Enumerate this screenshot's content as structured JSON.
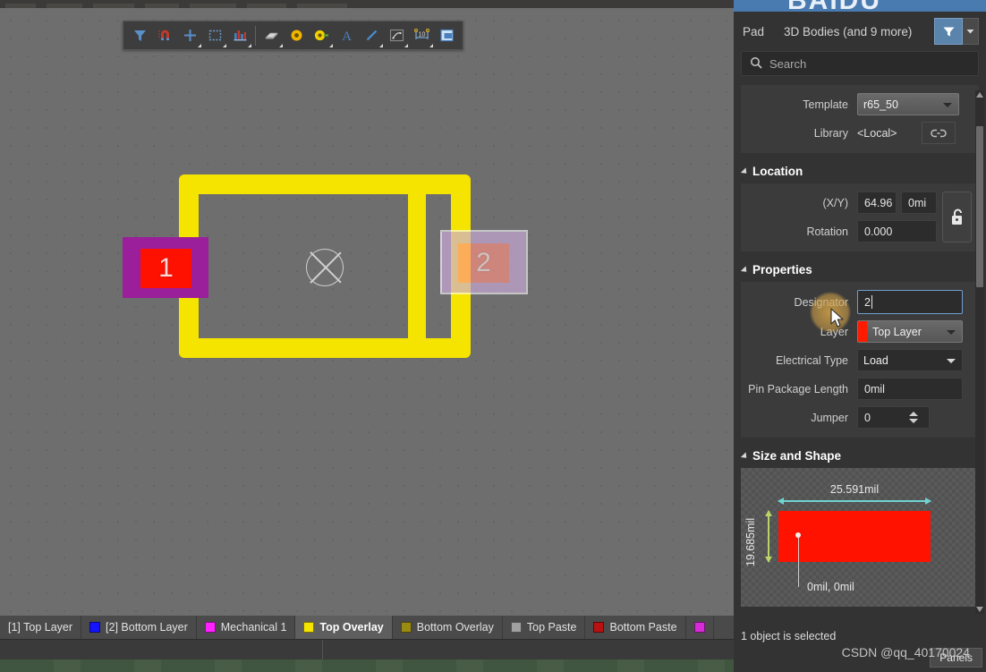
{
  "banner": {
    "text": "BAIDU"
  },
  "toolbar": {
    "items": [
      {
        "name": "filter-tool-icon",
        "label": "Filter"
      },
      {
        "name": "magnet-snap-icon",
        "label": "Snap"
      },
      {
        "name": "crosshair-place-icon",
        "label": "Place"
      },
      {
        "name": "selection-rectangle-icon",
        "label": "Select Area"
      },
      {
        "name": "component-place-icon",
        "label": "Place Component"
      },
      {
        "name": "three-d-body-icon",
        "label": "Place 3D Body"
      },
      {
        "name": "via-icon",
        "label": "Place Via"
      },
      {
        "name": "pad-icon",
        "label": "Place Pad"
      },
      {
        "name": "text-string-icon",
        "label": "Place String"
      },
      {
        "name": "line-icon",
        "label": "Place Line"
      },
      {
        "name": "arc-icon",
        "label": "Place Arc"
      },
      {
        "name": "dimension-icon",
        "label": "Place Dimension"
      },
      {
        "name": "polygon-pour-icon",
        "label": "Place Polygon Pour"
      }
    ]
  },
  "canvas": {
    "pads": [
      {
        "designator": "1",
        "selected": false
      },
      {
        "designator": "2",
        "selected": true
      }
    ]
  },
  "layer_tabs": [
    {
      "label": "[1] Top Layer",
      "color": "",
      "active": false,
      "swatch": false
    },
    {
      "label": "[2] Bottom Layer",
      "color": "#1414ff",
      "active": false,
      "swatch": true
    },
    {
      "label": "Mechanical 1",
      "color": "#ff21ff",
      "active": false,
      "swatch": true
    },
    {
      "label": "Top Overlay",
      "color": "#f5e400",
      "active": true,
      "swatch": true
    },
    {
      "label": "Bottom Overlay",
      "color": "#9c8b12",
      "active": false,
      "swatch": true
    },
    {
      "label": "Top Paste",
      "color": "#a0a0a0",
      "active": false,
      "swatch": true
    },
    {
      "label": "Bottom Paste",
      "color": "#b81111",
      "active": false,
      "swatch": true
    },
    {
      "label": "",
      "color": "#d62bd6",
      "active": false,
      "swatch": true
    }
  ],
  "panel": {
    "object_kind": "Pad",
    "scope": "3D Bodies (and 9 more)",
    "search": {
      "placeholder": "Search",
      "value": ""
    },
    "general": {
      "template_label": "Template",
      "template_value": "r65_50",
      "library_label": "Library",
      "library_value": "<Local>"
    },
    "location": {
      "title": "Location",
      "xy_label": "(X/Y)",
      "x_value": "64.96",
      "y_value": "0mi",
      "rotation_label": "Rotation",
      "rotation_value": "0.000"
    },
    "properties": {
      "title": "Properties",
      "designator_label": "Designator",
      "designator_value": "2",
      "layer_label": "Layer",
      "layer_value": "Top Layer",
      "layer_color": "#ff1a00",
      "electrical_type_label": "Electrical Type",
      "electrical_type_value": "Load",
      "pin_package_length_label": "Pin Package Length",
      "pin_package_length_value": "0mil",
      "jumper_label": "Jumper",
      "jumper_value": "0"
    },
    "size_and_shape": {
      "title": "Size and Shape",
      "width_value": "25.591mil",
      "height_value": "19.685mil",
      "origin_value": "0mil, 0mil",
      "pad_color": "#ff1200"
    }
  },
  "status": {
    "text": "1 object is selected"
  },
  "panels_button": {
    "label": "Panels"
  },
  "watermark": {
    "text": "CSDN @qq_40170024"
  }
}
